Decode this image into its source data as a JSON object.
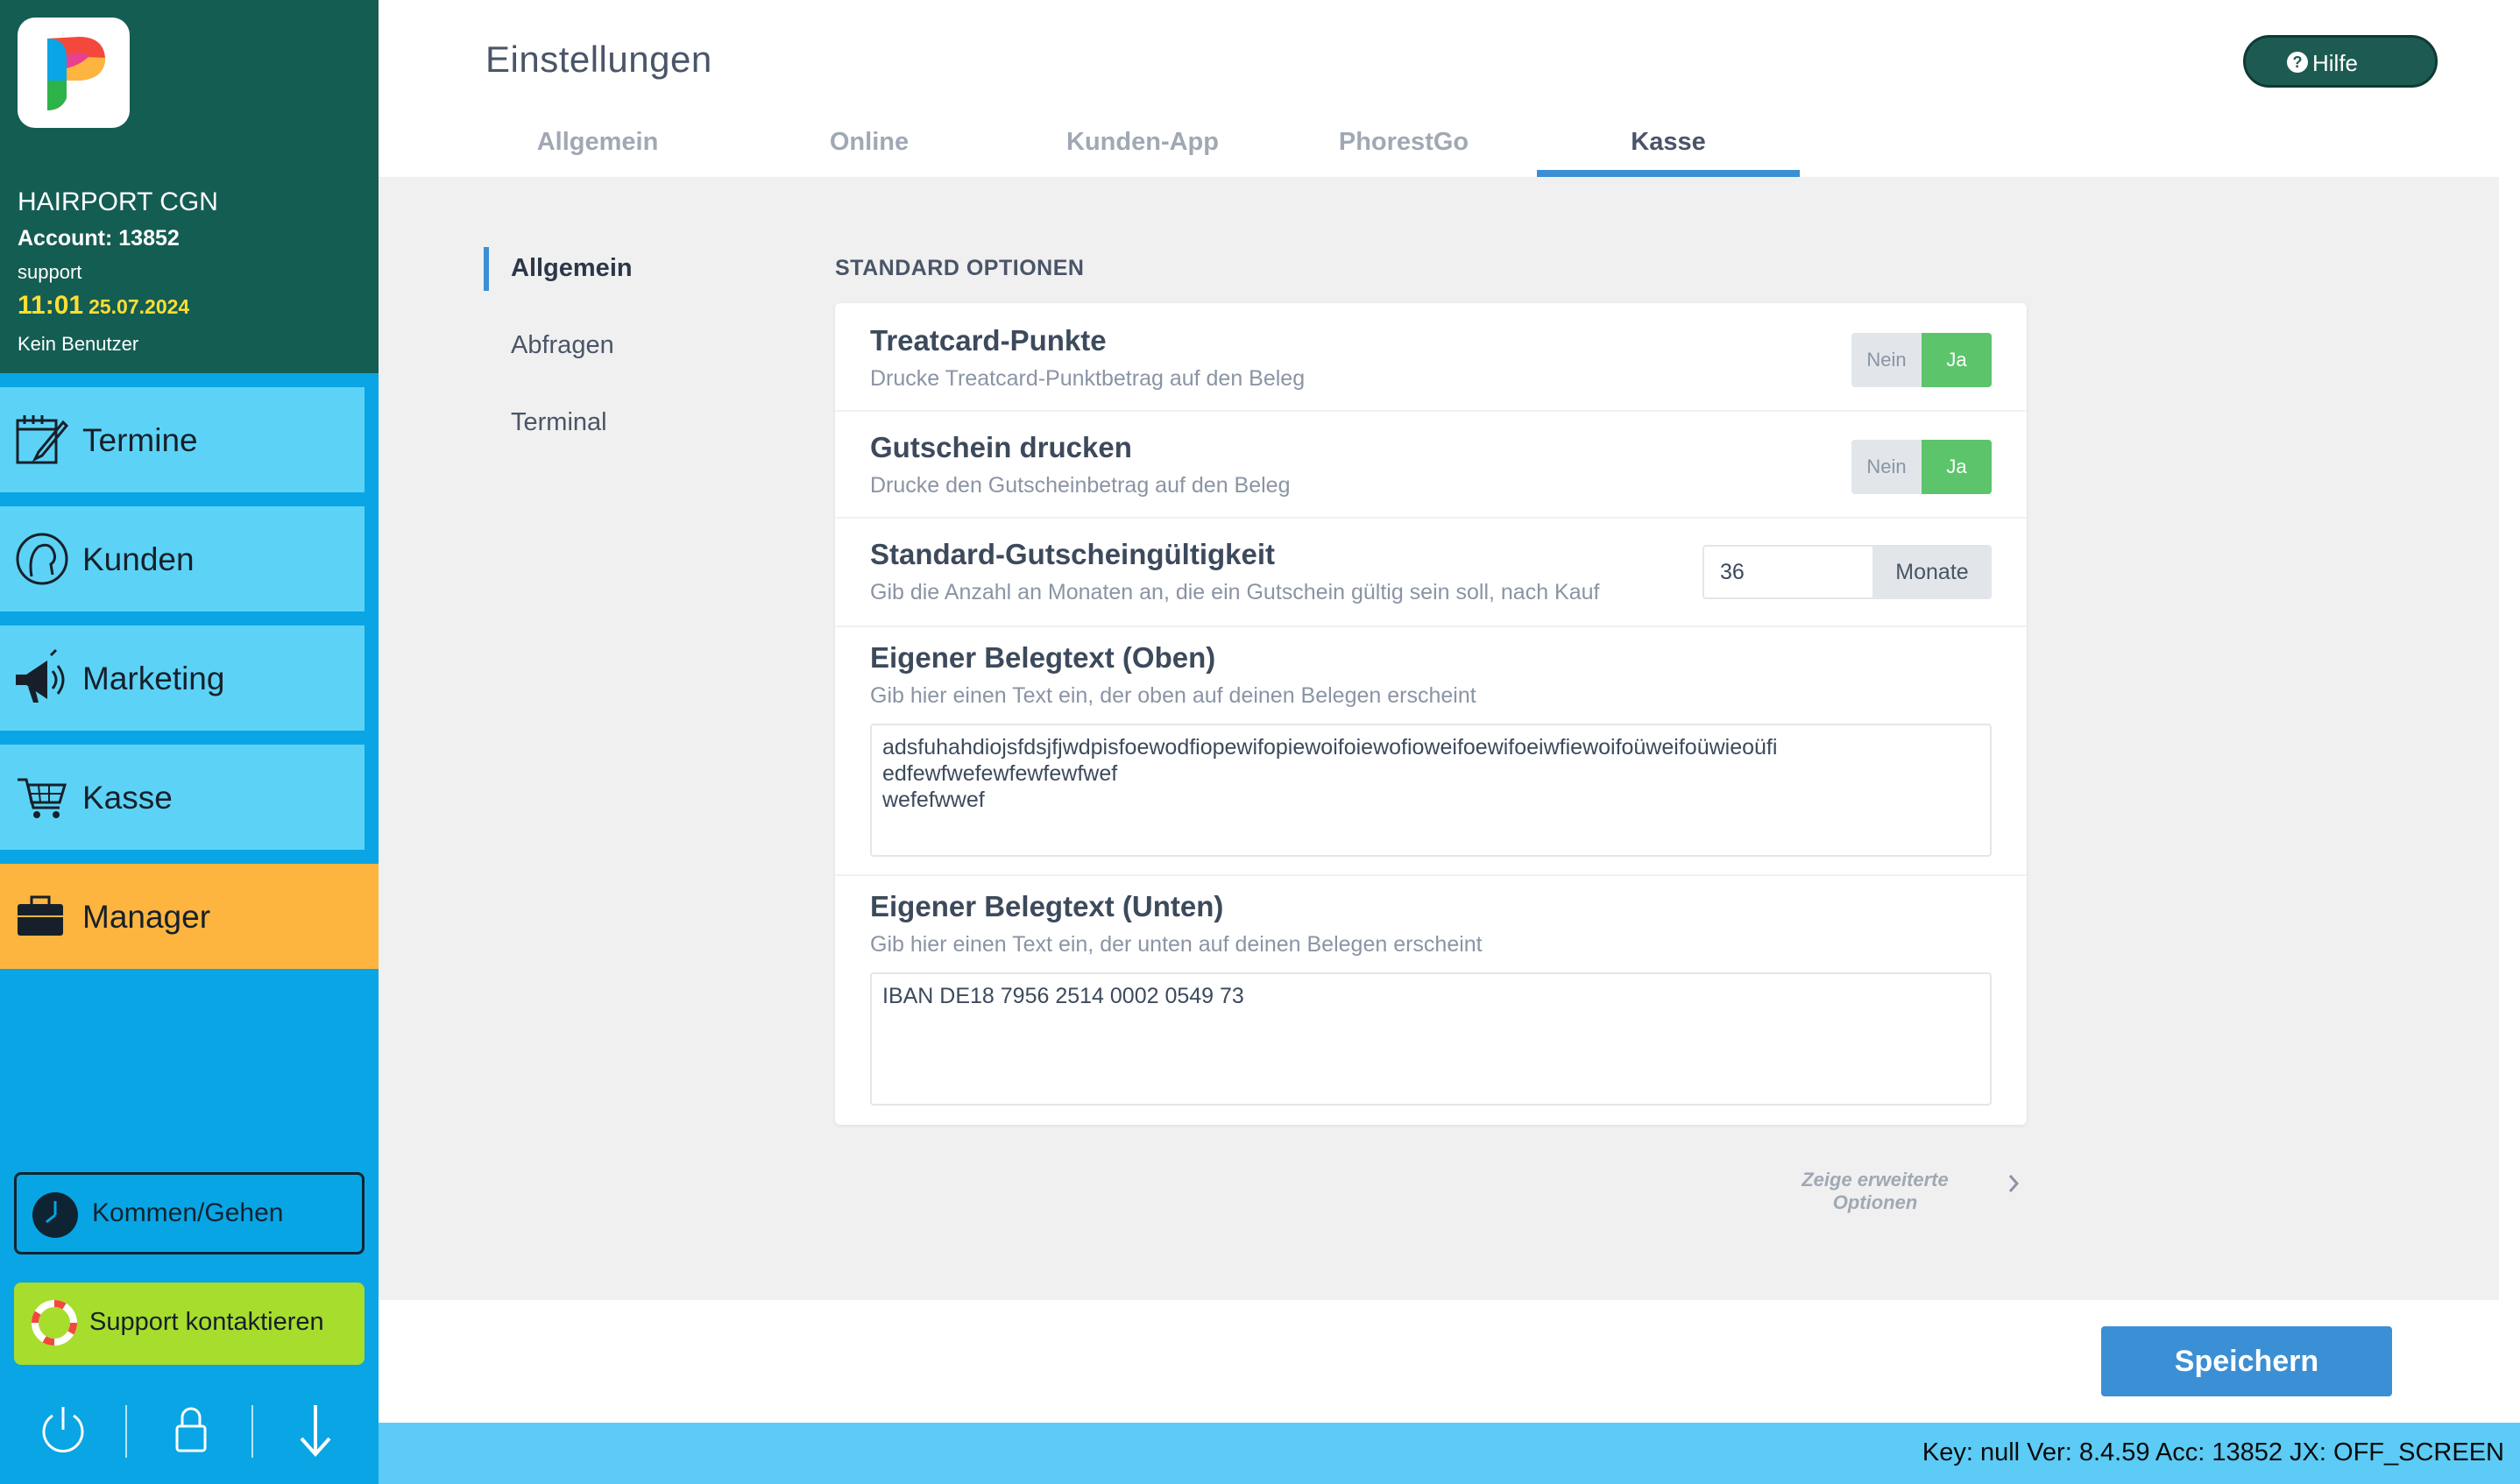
{
  "sidebar": {
    "salon_name": "HAIRPORT CGN",
    "account": "Account: 13852",
    "user": "support",
    "time": "11:01",
    "date": "25.07.2024",
    "no_user": "Kein Benutzer",
    "nav": [
      {
        "label": "Termine",
        "icon": "calendar-edit-icon"
      },
      {
        "label": "Kunden",
        "icon": "customer-head-icon"
      },
      {
        "label": "Marketing",
        "icon": "megaphone-icon"
      },
      {
        "label": "Kasse",
        "icon": "shopping-cart-icon"
      },
      {
        "label": "Manager",
        "icon": "briefcase-icon"
      }
    ],
    "kommen_gehen": "Kommen/Gehen",
    "support": "Support kontaktieren"
  },
  "header": {
    "title": "Einstellungen",
    "help": "Hilfe",
    "tabs": [
      "Allgemein",
      "Online",
      "Kunden-App",
      "PhorestGo",
      "Kasse"
    ],
    "active_tab": "Kasse"
  },
  "subnav": {
    "items": [
      "Allgemein",
      "Abfragen",
      "Terminal"
    ],
    "active": "Allgemein"
  },
  "main": {
    "section_title": "STANDARD OPTIONEN",
    "rows": {
      "treatcard": {
        "title": "Treatcard-Punkte",
        "desc": "Drucke Treatcard-Punktbetrag auf den Beleg",
        "off": "Nein",
        "on": "Ja",
        "value": "Ja"
      },
      "gutschein": {
        "title": "Gutschein drucken",
        "desc": "Drucke den Gutscheinbetrag auf den Beleg",
        "off": "Nein",
        "on": "Ja",
        "value": "Ja"
      },
      "gueltigkeit": {
        "title": "Standard-Gutscheingültigkeit",
        "desc": "Gib die Anzahl an Monaten an, die ein Gutschein gültig sein soll, nach Kauf",
        "value": "36",
        "unit": "Monate"
      },
      "beleg_oben": {
        "title": "Eigener Belegtext (Oben)",
        "desc": "Gib hier einen Text ein, der oben auf deinen Belegen erscheint",
        "value": "adsfuhahdiojsfdsjfjwdpisfoewodfiopewifopiewoifoiewofioweifoewifoeiwfiewoifoüweifoüwieoüfi\nedfewfwefewfewfewfwef\nwefefwwef"
      },
      "beleg_unten": {
        "title": "Eigener Belegtext (Unten)",
        "desc": "Gib hier einen Text ein, der unten auf deinen Belegen erscheint",
        "value": "IBAN DE18 7956 2514 0002 0549 73"
      }
    },
    "more_options": "Zeige erweiterte Optionen"
  },
  "footer": {
    "save": "Speichern"
  },
  "status_bar": "Key: null Ver: 8.4.59 Acc: 13852  JX: OFF_SCREEN",
  "colors": {
    "sidebar_header": "#145d52",
    "sidebar_bg": "#0aa5e4",
    "nav_button": "#5cd3f6",
    "manager_active": "#fdb53f",
    "support_button": "#a7dd2c",
    "toggle_on": "#5cc46b",
    "accent": "#3b8fd4",
    "clock": "#ffde33"
  }
}
